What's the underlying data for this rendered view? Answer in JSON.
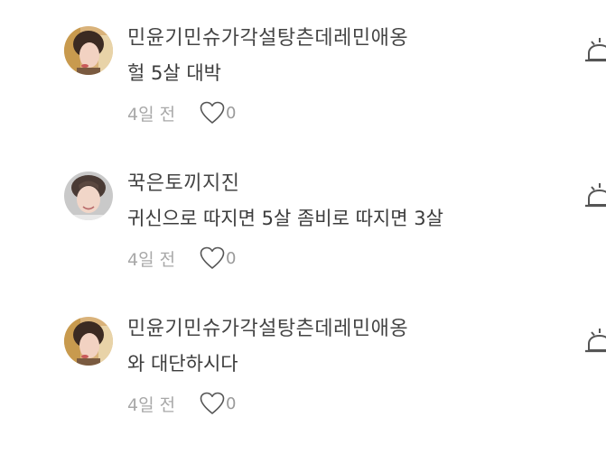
{
  "comments": [
    {
      "username": "민윤기민슈가각설탕츤데레민애옹",
      "text": "헐 5살 대박",
      "time": "4일 전",
      "likes": "0",
      "avatar_icon": "profile-photo-avatar",
      "like_icon": "heart-outline-icon",
      "report_icon": "siren-report-icon"
    },
    {
      "username": "꾹은토끼지진",
      "text": "귀신으로 따지면 5살 좀비로 따지면 3살",
      "time": "4일 전",
      "likes": "0",
      "avatar_icon": "profile-photo-avatar",
      "like_icon": "heart-outline-icon",
      "report_icon": "siren-report-icon"
    },
    {
      "username": "민윤기민슈가각설탕츤데레민애옹",
      "text": "와 대단하시다",
      "time": "4일 전",
      "likes": "0",
      "avatar_icon": "profile-photo-avatar",
      "like_icon": "heart-outline-icon",
      "report_icon": "siren-report-icon"
    }
  ],
  "colors": {
    "text": "#3c3c3c",
    "muted": "#a8a8a8",
    "icon": "#555555"
  }
}
